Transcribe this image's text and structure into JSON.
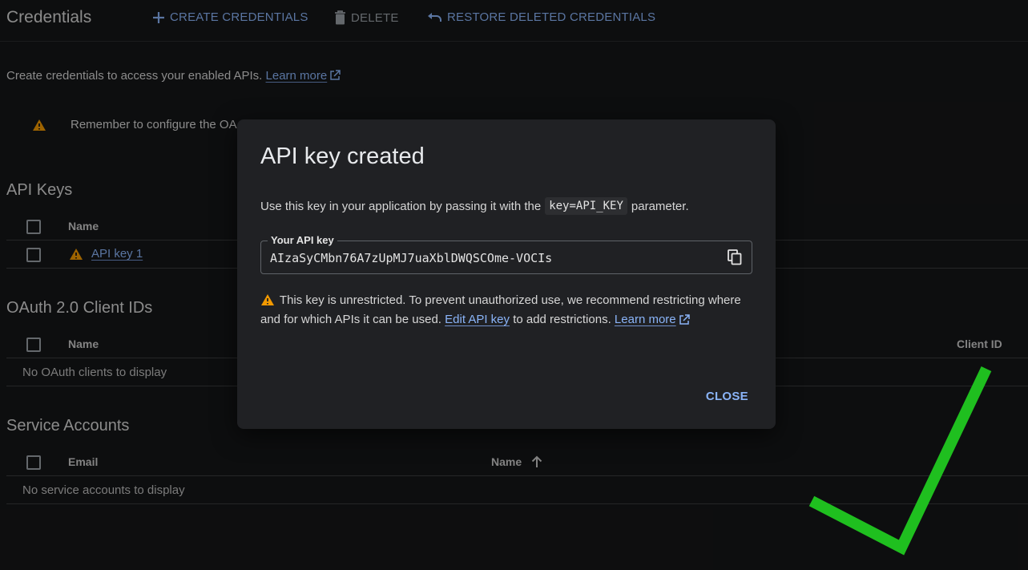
{
  "header": {
    "title": "Credentials",
    "create_label": "CREATE CREDENTIALS",
    "delete_label": "DELETE",
    "restore_label": "RESTORE DELETED CREDENTIALS"
  },
  "intro": {
    "text": "Create credentials to access your enabled APIs.",
    "learn_more": "Learn more"
  },
  "banner": {
    "text": "Remember to configure the OA"
  },
  "api_keys": {
    "title": "API Keys",
    "col_name": "Name",
    "rows": [
      {
        "name": "API key 1"
      }
    ]
  },
  "oauth": {
    "title": "OAuth 2.0 Client IDs",
    "col_name": "Name",
    "col_client_id": "Client ID",
    "empty": "No OAuth clients to display"
  },
  "service_accounts": {
    "title": "Service Accounts",
    "col_email": "Email",
    "col_name": "Name",
    "empty": "No service accounts to display"
  },
  "dialog": {
    "title": "API key created",
    "text_before": "Use this key in your application by passing it with the",
    "code": "key=API_KEY",
    "text_after": "parameter.",
    "key_label": "Your API key",
    "key_value": "AIzaSyCMbn76A7zUpMJ7uaXblDWQSCOme-VOCIs",
    "warn_text_1": "This key is unrestricted. To prevent unauthorized use, we recommend restricting where and for which APIs it can be used.",
    "edit_link": "Edit API key",
    "warn_text_2": "to add restrictions.",
    "learn_more": "Learn more",
    "close_label": "CLOSE"
  },
  "colors": {
    "background": "#151617",
    "accent": "#8ab4f8",
    "warning": "#f29900",
    "checkmark": "#1fbf1f",
    "dialog": "#202124"
  }
}
